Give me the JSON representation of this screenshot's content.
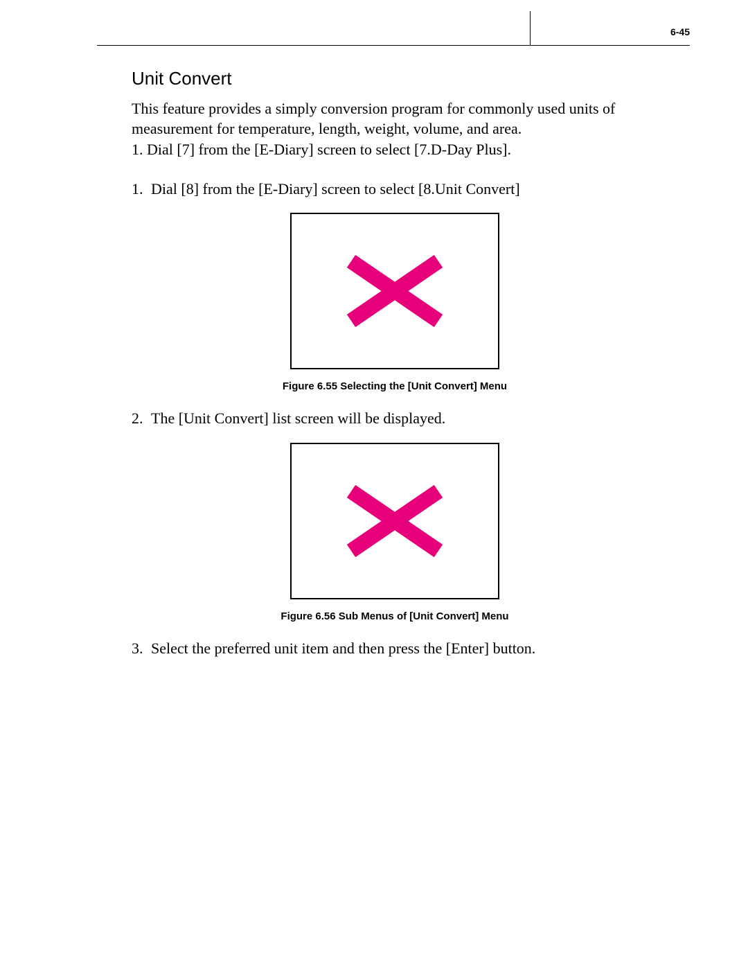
{
  "header": {
    "page_number": "6-45"
  },
  "section": {
    "title": "Unit Convert",
    "intro": [
      "This feature provides a simply conversion program for commonly used units of measurement for temperature, length, weight, volume, and area.",
      "1. Dial [7] from the [E-Diary] screen to select [7.D-Day Plus]."
    ]
  },
  "steps": [
    {
      "num": "1.",
      "text": "Dial [8] from the [E-Diary] screen to select [8.Unit Convert]"
    },
    {
      "num": "2.",
      "text": "The [Unit Convert] list screen will be displayed."
    },
    {
      "num": "3.",
      "text": "Select the preferred unit item and then press the [Enter] button."
    }
  ],
  "figures": [
    {
      "caption": "Figure 6.55  Selecting the [Unit Convert] Menu"
    },
    {
      "caption": "Figure 6.56  Sub Menus of [Unit Convert] Menu"
    }
  ]
}
